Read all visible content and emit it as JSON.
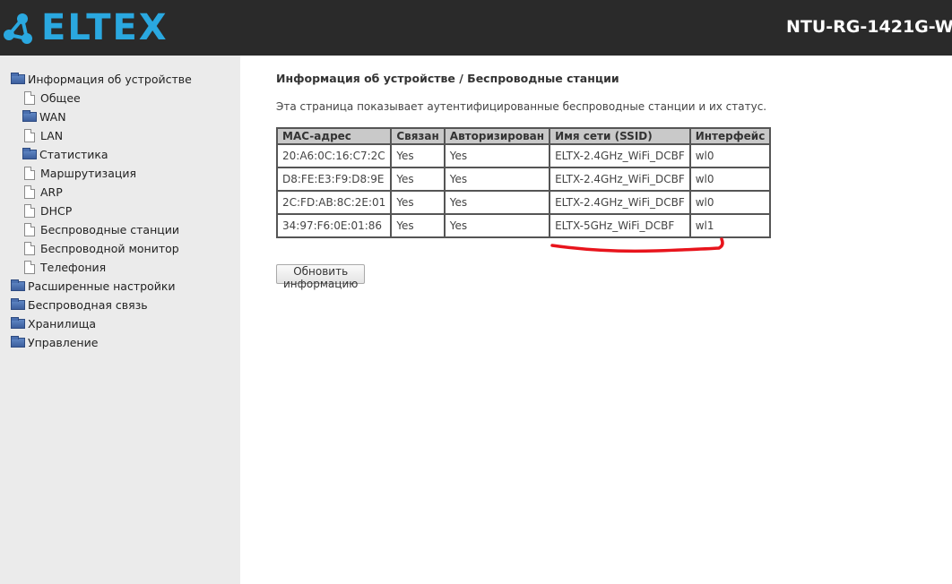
{
  "header": {
    "logo_text": "ELTEX",
    "model": "NTU-RG-1421G-W",
    "brand_color": "#2aa8e0"
  },
  "sidebar": {
    "items": [
      {
        "label": "Информация об устройстве",
        "icon": "folder-icon"
      },
      {
        "label": "Общее",
        "icon": "document-icon"
      },
      {
        "label": "WAN",
        "icon": "folder-icon"
      },
      {
        "label": "LAN",
        "icon": "document-icon"
      },
      {
        "label": "Статистика",
        "icon": "folder-icon"
      },
      {
        "label": "Маршрутизация",
        "icon": "document-icon"
      },
      {
        "label": "ARP",
        "icon": "document-icon"
      },
      {
        "label": "DHCP",
        "icon": "document-icon"
      },
      {
        "label": "Беспроводные станции",
        "icon": "document-icon"
      },
      {
        "label": "Беспроводной монитор",
        "icon": "document-icon"
      },
      {
        "label": "Телефония",
        "icon": "document-icon"
      },
      {
        "label": "Расширенные настройки",
        "icon": "folder-icon"
      },
      {
        "label": "Беспроводная связь",
        "icon": "folder-icon"
      },
      {
        "label": "Хранилища",
        "icon": "folder-icon"
      },
      {
        "label": "Управление",
        "icon": "folder-icon"
      }
    ]
  },
  "main": {
    "title": "Информация об устройстве / Беспроводные станции",
    "description": "Эта страница показывает аутентифицированные беспроводные станции и их статус.",
    "table": {
      "headers": [
        "MAC-адрес",
        "Связан",
        "Авторизирован",
        "Имя сети (SSID)",
        "Интерфейс"
      ],
      "rows": [
        [
          "20:A6:0C:16:C7:2C",
          "Yes",
          "Yes",
          "ELTX-2.4GHz_WiFi_DCBF",
          "wl0"
        ],
        [
          "D8:FE:E3:F9:D8:9E",
          "Yes",
          "Yes",
          "ELTX-2.4GHz_WiFi_DCBF",
          "wl0"
        ],
        [
          "2C:FD:AB:8C:2E:01",
          "Yes",
          "Yes",
          "ELTX-2.4GHz_WiFi_DCBF",
          "wl0"
        ],
        [
          "34:97:F6:0E:01:86",
          "Yes",
          "Yes",
          "ELTX-5GHz_WiFi_DCBF",
          "wl1"
        ]
      ]
    },
    "refresh_button": "Обновить информацию",
    "annotation_color": "#e8141c"
  }
}
